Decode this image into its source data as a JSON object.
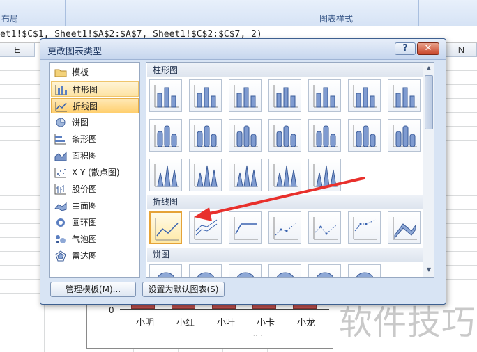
{
  "ribbon": {
    "group_left": "布局",
    "group_right": "图表样式"
  },
  "formula_bar": {
    "text": "et1!$C$1, Sheet1!$A$2:$A$7, Sheet1!$C$2:$C$7, 2)"
  },
  "columns": {
    "e": "E",
    "n": "N"
  },
  "chart": {
    "zero": "0",
    "categories": [
      "小明",
      "小红",
      "小叶",
      "小卡",
      "小龙"
    ],
    "bar_color": "#c0504d"
  },
  "dialog": {
    "title": "更改图表类型",
    "help": "?",
    "close": "✕",
    "left_items": [
      {
        "label": "模板",
        "icon": "folder-icon"
      },
      {
        "label": "柱形图",
        "icon": "column-chart-icon"
      },
      {
        "label": "折线图",
        "icon": "line-chart-icon"
      },
      {
        "label": "饼图",
        "icon": "pie-chart-icon"
      },
      {
        "label": "条形图",
        "icon": "bar-chart-icon"
      },
      {
        "label": "面积图",
        "icon": "area-chart-icon"
      },
      {
        "label": "X Y (散点图)",
        "icon": "scatter-chart-icon"
      },
      {
        "label": "股价图",
        "icon": "stock-chart-icon"
      },
      {
        "label": "曲面图",
        "icon": "surface-chart-icon"
      },
      {
        "label": "圆环图",
        "icon": "doughnut-chart-icon"
      },
      {
        "label": "气泡图",
        "icon": "bubble-chart-icon"
      },
      {
        "label": "雷达图",
        "icon": "radar-chart-icon"
      }
    ],
    "section_column": "柱形图",
    "section_line": "折线图",
    "section_pie": "饼图",
    "manage_templates": "管理模板(M)...",
    "set_default": "设置为默认图表(S)",
    "accent": "#ffcf6e"
  },
  "watermark": "软件技巧",
  "annotation_arrow_color": "#e8302c"
}
